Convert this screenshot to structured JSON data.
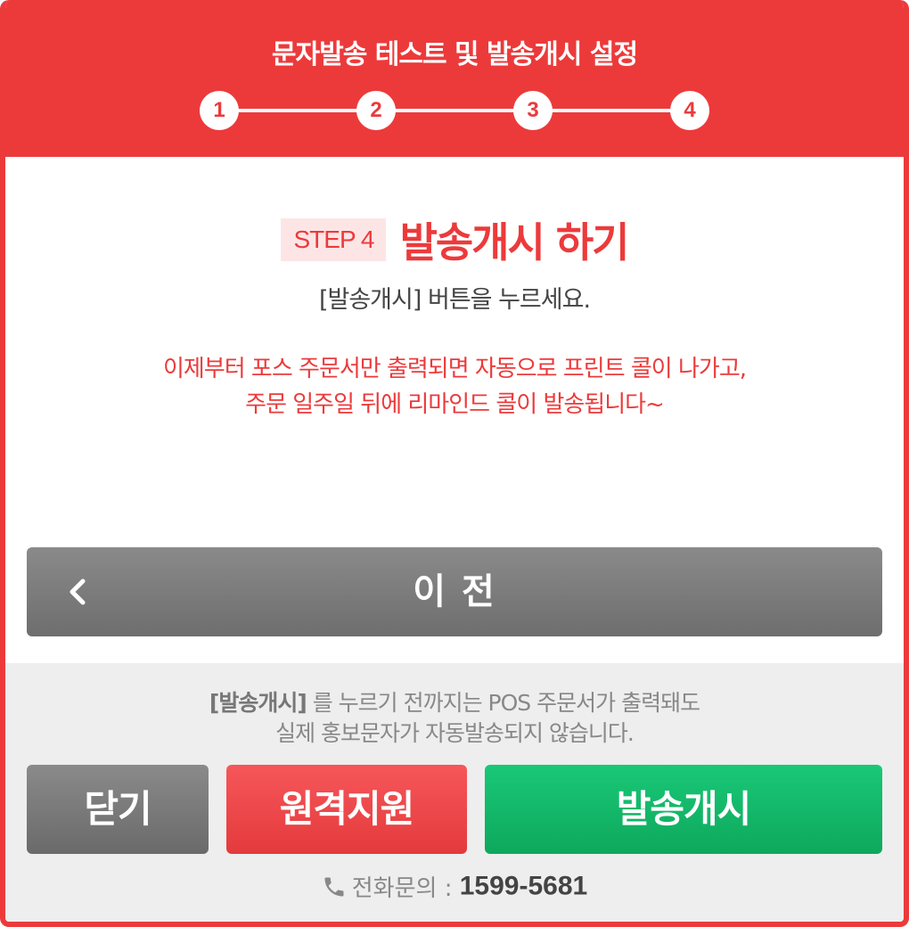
{
  "header": {
    "title": "문자발송 테스트 및 발송개시 설정",
    "steps": [
      "1",
      "2",
      "3",
      "4"
    ]
  },
  "step": {
    "badge": "STEP 4",
    "title": "발송개시 하기",
    "instruction": "[발송개시] 버튼을 누르세요.",
    "notice_line1": "이제부터 포스 주문서만 출력되면 자동으로 프린트 콜이 나가고,",
    "notice_line2": "주문 일주일 뒤에 리마인드 콜이 발송됩니다~"
  },
  "prev_button": {
    "label": "이 전",
    "icon": "chevron-left-icon"
  },
  "footer": {
    "note_bold": "[발송개시]",
    "note_line1": " 를 누르기 전까지는 POS 주문서가 출력돼도",
    "note_line2": "실제 홍보문자가 자동발송되지 않습니다.",
    "close_label": "닫기",
    "remote_label": "원격지원",
    "send_label": "발송개시",
    "contact_label": "전화문의 : ",
    "contact_number": "1599-5681"
  },
  "colors": {
    "primary_red": "#ec3a3b",
    "send_green": "#13b86a",
    "neutral_gray": "#7a7a7a"
  }
}
